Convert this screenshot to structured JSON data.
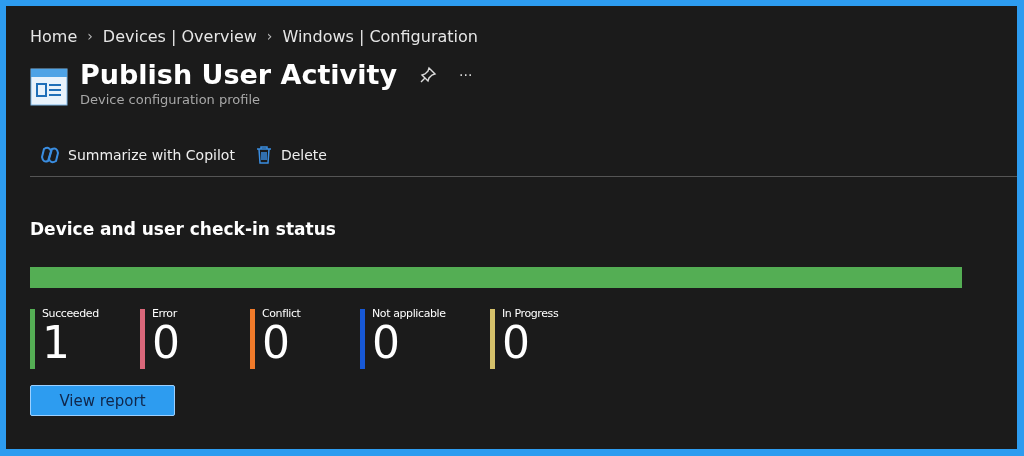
{
  "breadcrumb": [
    {
      "label": "Home"
    },
    {
      "label": "Devices | Overview"
    },
    {
      "label": "Windows | Configuration"
    }
  ],
  "breadcrumb_separator": "›",
  "header": {
    "title": "Publish User Activity",
    "subtitle": "Device configuration profile",
    "more": "···"
  },
  "toolbar": [
    {
      "kind": "copilot",
      "label": "Summarize with Copilot"
    },
    {
      "kind": "delete",
      "label": "Delete"
    }
  ],
  "section_title": "Device and user check-in status",
  "statuses": [
    {
      "label": "Succeeded",
      "count": "1",
      "color": "#54ae54"
    },
    {
      "label": "Error",
      "count": "0",
      "color": "#d9677a"
    },
    {
      "label": "Conflict",
      "count": "0",
      "color": "#f07a2a"
    },
    {
      "label": "Not applicable",
      "count": "0",
      "color": "#1758d6"
    },
    {
      "label": "In Progress",
      "count": "0",
      "color": "#d4c06a"
    }
  ],
  "button": "View report"
}
